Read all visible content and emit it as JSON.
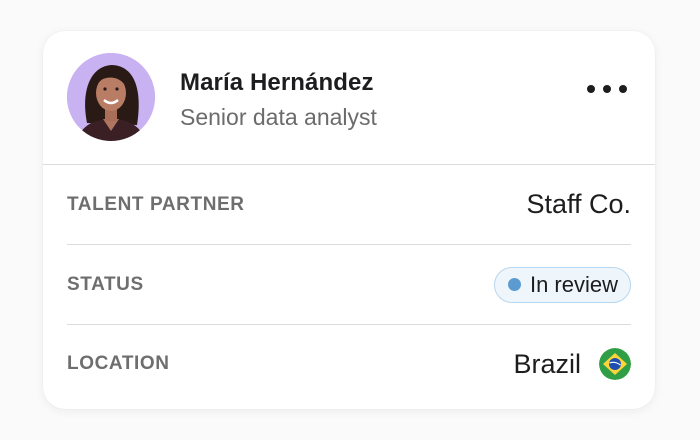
{
  "profile": {
    "name": "María Hernández",
    "role": "Senior data analyst",
    "avatar_icon": "person-portrait"
  },
  "menu_icon": "more-horizontal-icon",
  "rows": {
    "talent_partner": {
      "label": "TALENT PARTNER",
      "value": "Staff Co."
    },
    "status": {
      "label": "STATUS",
      "value": "In review",
      "color": "#5b9bd0"
    },
    "location": {
      "label": "LOCATION",
      "value": "Brazil",
      "flag_icon": "brazil-flag-icon"
    }
  },
  "colors": {
    "avatar_bg": "#c9b2f2",
    "badge_bg": "#eef6fc",
    "badge_border": "#b7d6ef"
  }
}
